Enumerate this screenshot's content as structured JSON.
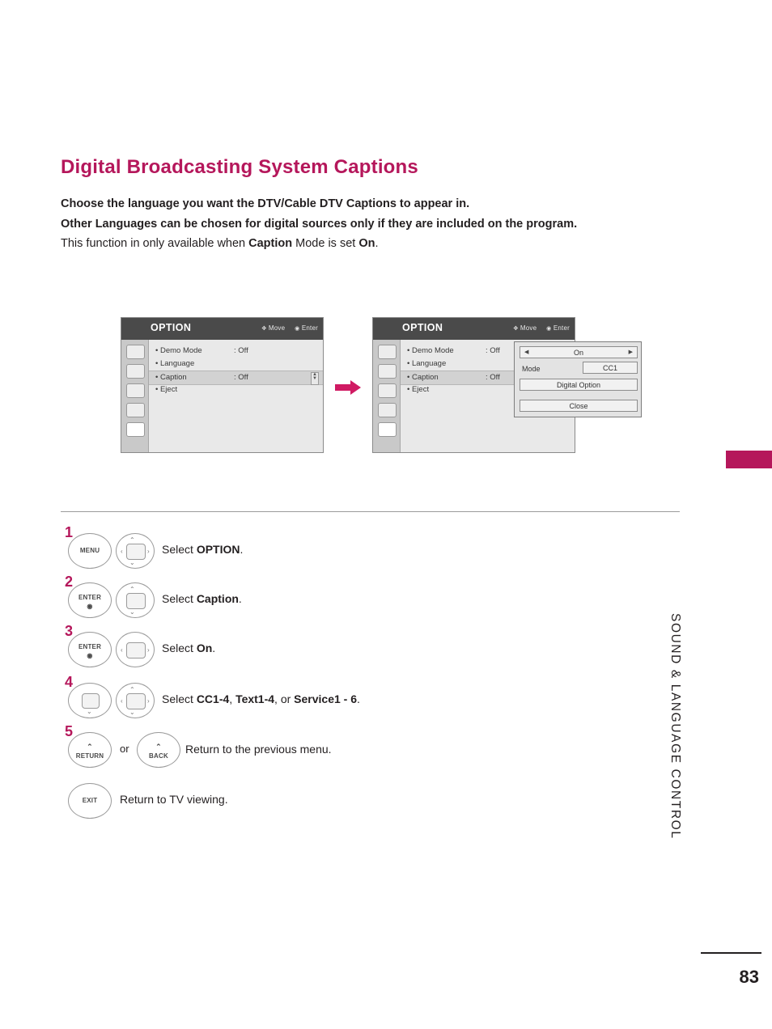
{
  "page": {
    "title": "Digital Broadcasting System Captions",
    "intro_lines": [
      "Choose the language you want the DTV/Cable DTV Captions to appear in.",
      "Other Languages can be chosen for digital sources only if they are included on the program."
    ],
    "intro_line3_a": "This function in only available when ",
    "intro_line3_b": "Caption",
    "intro_line3_c": " Mode is set ",
    "intro_line3_d": "On",
    "intro_line3_e": ".",
    "side_text": "SOUND & LANGUAGE CONTROL",
    "page_number": "83",
    "accent_color": "#b5175b"
  },
  "osd_left": {
    "title": "OPTION",
    "hint_move": "Move",
    "hint_enter": "Enter",
    "rows": [
      {
        "label": "• Demo Mode",
        "value": ": Off"
      },
      {
        "label": "• Language",
        "value": ""
      },
      {
        "label": "• Caption",
        "value": ": Off"
      },
      {
        "label": "• Eject",
        "value": ""
      }
    ]
  },
  "osd_right": {
    "title": "OPTION",
    "hint_move": "Move",
    "hint_enter": "Enter",
    "rows": [
      {
        "label": "• Demo Mode",
        "value": ": Off"
      },
      {
        "label": "• Language",
        "value": ""
      },
      {
        "label": "• Caption",
        "value": ": Off"
      },
      {
        "label": "• Eject",
        "value": ""
      }
    ],
    "popup": {
      "on_value": "On",
      "arrow_left": "◀",
      "arrow_right": "▶",
      "mode_label": "Mode",
      "mode_value": "CC1",
      "digital_option": "Digital Option",
      "close": "Close"
    }
  },
  "steps": [
    {
      "number": "1",
      "key1": "MENU",
      "key2": "nav-pad",
      "text_a": "Select ",
      "text_b": "OPTION",
      "text_c": "."
    },
    {
      "number": "2",
      "key1": "ENTER",
      "key2": "nav-pad-vertical",
      "text_a": "Select ",
      "text_b": "Caption",
      "text_c": "."
    },
    {
      "number": "3",
      "key1": "ENTER",
      "key2": "nav-pad-horizontal",
      "text_a": "Select ",
      "text_b": "On",
      "text_c": "."
    },
    {
      "number": "4",
      "key1": "nav-pad-down",
      "key2": "nav-pad",
      "text_a": "Select ",
      "text_b": "CC1-4",
      "text_c": ", ",
      "text_d": "Text1-4",
      "text_e": ", or ",
      "text_f": "Service1 - 6",
      "text_g": "."
    },
    {
      "number": "5",
      "key1": "RETURN",
      "or": "or",
      "key2": "BACK",
      "text": "Return to the previous menu."
    }
  ],
  "exit_row": {
    "key": "EXIT",
    "text": "Return to TV viewing."
  }
}
